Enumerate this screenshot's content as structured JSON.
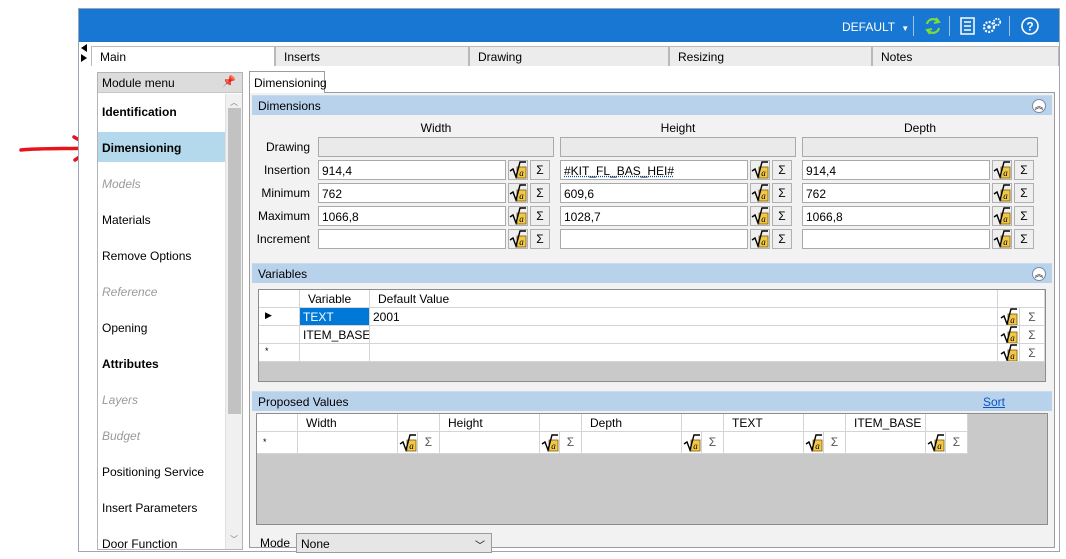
{
  "topbar": {
    "profile_label": "DEFAULT",
    "icons": [
      "refresh-icon",
      "list-icon",
      "settings-icon",
      "help-icon"
    ]
  },
  "main_tabs": [
    {
      "label": "Main",
      "active": true
    },
    {
      "label": "Inserts",
      "active": false
    },
    {
      "label": "Drawing",
      "active": false
    },
    {
      "label": "Resizing",
      "active": false
    },
    {
      "label": "Notes",
      "active": false
    }
  ],
  "module_menu": {
    "title": "Module menu",
    "items": [
      {
        "label": "Identification",
        "style": "bold"
      },
      {
        "label": "Dimensioning",
        "style": "bold-selected"
      },
      {
        "label": "Models",
        "style": "disabled"
      },
      {
        "label": "Materials",
        "style": "normal"
      },
      {
        "label": "Remove Options",
        "style": "normal"
      },
      {
        "label": "Reference",
        "style": "disabled"
      },
      {
        "label": "Opening",
        "style": "normal"
      },
      {
        "label": "Attributes",
        "style": "bold"
      },
      {
        "label": "Layers",
        "style": "disabled"
      },
      {
        "label": "Budget",
        "style": "disabled"
      },
      {
        "label": "Positioning Service",
        "style": "normal"
      },
      {
        "label": "Insert Parameters",
        "style": "normal"
      },
      {
        "label": "Door Function",
        "style": "normal"
      }
    ]
  },
  "sub_tab": "Dimensioning",
  "dimensions": {
    "title": "Dimensions",
    "columns": [
      "Width",
      "Height",
      "Depth"
    ],
    "rows": [
      {
        "label": "Drawing",
        "values": [
          "",
          "",
          ""
        ],
        "readonly": true
      },
      {
        "label": "Insertion",
        "values": [
          "914,4",
          "#KIT_FL_BAS_HEI#",
          "914,4"
        ]
      },
      {
        "label": "Minimum",
        "values": [
          "762",
          "609,6",
          "762"
        ]
      },
      {
        "label": "Maximum",
        "values": [
          "1066,8",
          "1028,7",
          "1066,8"
        ]
      },
      {
        "label": "Increment",
        "values": [
          "",
          "",
          ""
        ]
      }
    ],
    "sigma": "Σ"
  },
  "variables": {
    "title": "Variables",
    "headers": [
      "Variable",
      "Default Value"
    ],
    "rows": [
      {
        "marker": "▶",
        "variable": "TEXT",
        "default": "2001"
      },
      {
        "marker": "",
        "variable": "ITEM_BASE",
        "default": ""
      },
      {
        "marker": "*",
        "variable": "",
        "default": ""
      }
    ]
  },
  "proposed": {
    "title": "Proposed Values",
    "sort_label": "Sort",
    "headers": [
      "Width",
      "Height",
      "Depth",
      "TEXT",
      "ITEM_BASE"
    ],
    "new_row_marker": "*"
  },
  "mode": {
    "label": "Mode",
    "value": "None"
  },
  "colors": {
    "topbar": "#1777d2",
    "section_header": "#b9d2ec",
    "selected_menu": "#b4d9ec",
    "selected_cell": "#0078d7",
    "annotation_arrow": "#e8141b"
  }
}
